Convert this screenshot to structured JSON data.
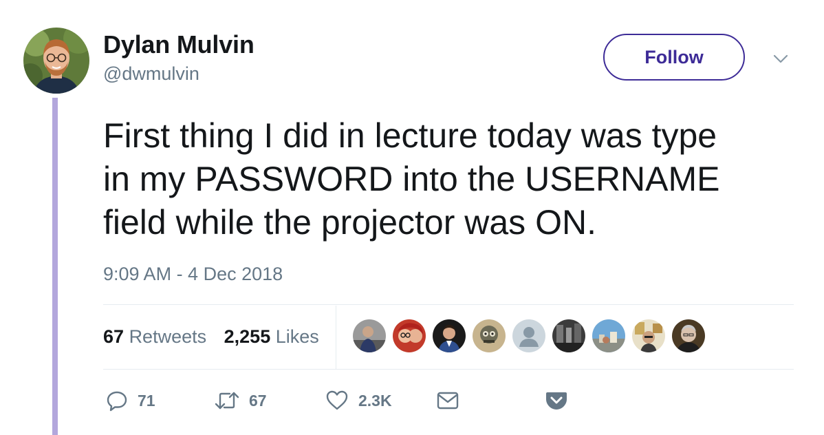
{
  "user": {
    "display_name": "Dylan Mulvin",
    "handle": "@dwmulvin"
  },
  "follow_label": "Follow",
  "tweet": {
    "text": "First thing I did in lecture today was type\nin my PASSWORD into the USERNAME\nfield while the projector was ON.",
    "timestamp": "9:09 AM - 4 Dec 2018"
  },
  "stats": {
    "retweets_count": "67",
    "retweets_label": "Retweets",
    "likes_count": "2,255",
    "likes_label": "Likes"
  },
  "actions": {
    "reply_count": "71",
    "retweet_count": "67",
    "like_count": "2.3K"
  },
  "icons": [
    "reply-icon",
    "retweet-icon",
    "like-icon",
    "direct-message-icon",
    "pocket-icon",
    "chevron-down-icon"
  ],
  "colors": {
    "accent": "#3d2b97",
    "thread_line": "#b3a7dc",
    "muted_text": "#657786",
    "text": "#14171a",
    "divider": "#e6ecf0"
  }
}
